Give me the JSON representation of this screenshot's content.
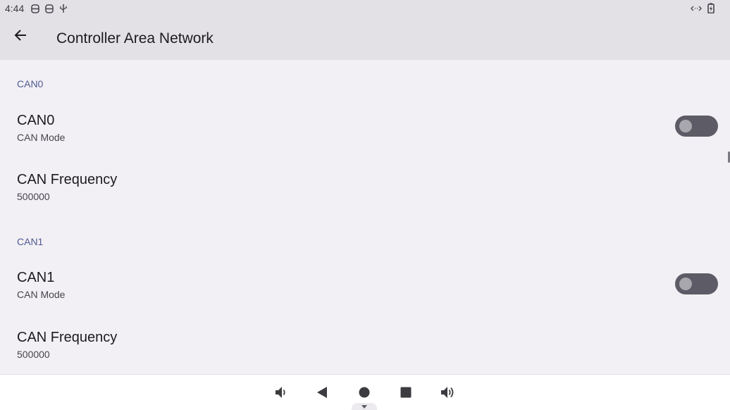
{
  "status_bar": {
    "time": "4:44",
    "left_icons": [
      "storage-icon",
      "storage-icon",
      "usb-icon"
    ],
    "right_icons": [
      "data-transfer-icon",
      "battery-icon"
    ]
  },
  "app_bar": {
    "title": "Controller Area Network"
  },
  "sections": [
    {
      "header": "CAN0",
      "mode": {
        "title": "CAN0",
        "summary": "CAN Mode",
        "enabled": false
      },
      "frequency": {
        "title": "CAN Frequency",
        "summary": "500000"
      }
    },
    {
      "header": "CAN1",
      "mode": {
        "title": "CAN1",
        "summary": "CAN Mode",
        "enabled": false
      },
      "frequency": {
        "title": "CAN Frequency",
        "summary": "500000"
      }
    }
  ],
  "nav_bar": {
    "buttons": [
      "volume-down-icon",
      "back-triangle-icon",
      "home-circle-icon",
      "recents-square-icon",
      "volume-up-icon"
    ]
  },
  "colors": {
    "app_bar_bg": "#e3e1e6",
    "content_bg": "#f3f0f5",
    "section_header": "#4f5b92",
    "switch_track_off": "#5d5c66",
    "switch_thumb_off": "#a9a7ae"
  }
}
